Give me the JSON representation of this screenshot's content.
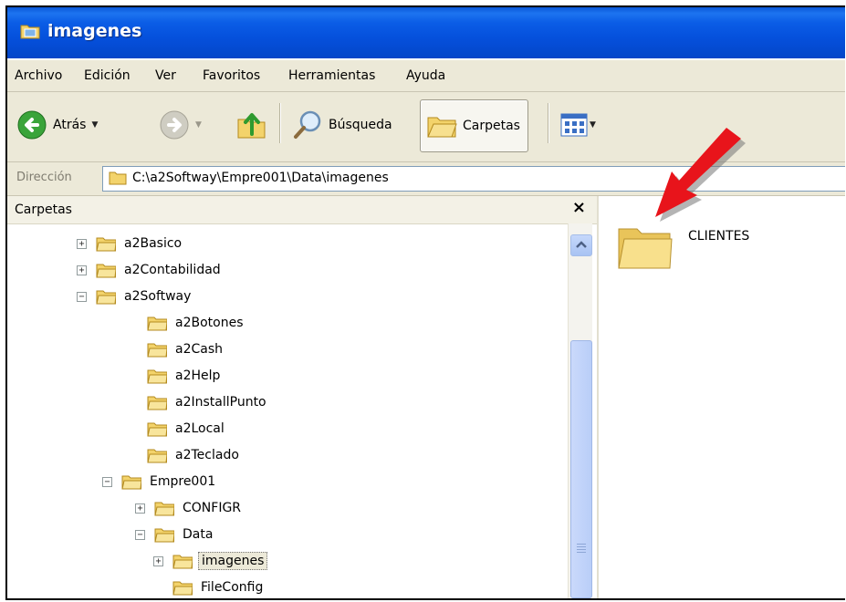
{
  "window": {
    "title": "imagenes"
  },
  "menu": [
    "Archivo",
    "Edición",
    "Ver",
    "Favoritos",
    "Herramientas",
    "Ayuda"
  ],
  "toolbar": {
    "back_label": "Atrás",
    "search_label": "Búsqueda",
    "folders_label": "Carpetas"
  },
  "address": {
    "label": "Dirección",
    "path": "C:\\a2Softway\\Empre001\\Data\\imagenes"
  },
  "folders_pane": {
    "title": "Carpetas",
    "close_glyph": "×",
    "tree": [
      {
        "label": "a2Basico",
        "expander": "+"
      },
      {
        "label": "a2Contabilidad",
        "expander": "+"
      },
      {
        "label": "a2Softway",
        "expander": "−"
      },
      {
        "label": "a2Botones",
        "expander": ""
      },
      {
        "label": "a2Cash",
        "expander": ""
      },
      {
        "label": "a2Help",
        "expander": ""
      },
      {
        "label": "a2InstallPunto",
        "expander": ""
      },
      {
        "label": "a2Local",
        "expander": ""
      },
      {
        "label": "a2Teclado",
        "expander": ""
      },
      {
        "label": "Empre001",
        "expander": "−"
      },
      {
        "label": "CONFIGR",
        "expander": "+"
      },
      {
        "label": "Data",
        "expander": "−"
      },
      {
        "label": "imagenes",
        "expander": "+",
        "selected": true
      },
      {
        "label": "FileConfig",
        "expander": ""
      }
    ]
  },
  "content": {
    "items": [
      {
        "label": "CLIENTES",
        "icon": "folder-icon"
      }
    ]
  },
  "colors": {
    "titlebar": "#0550dc",
    "chrome": "#ece9d8",
    "folder": "#f5d776",
    "arrow": "#e8141b"
  }
}
